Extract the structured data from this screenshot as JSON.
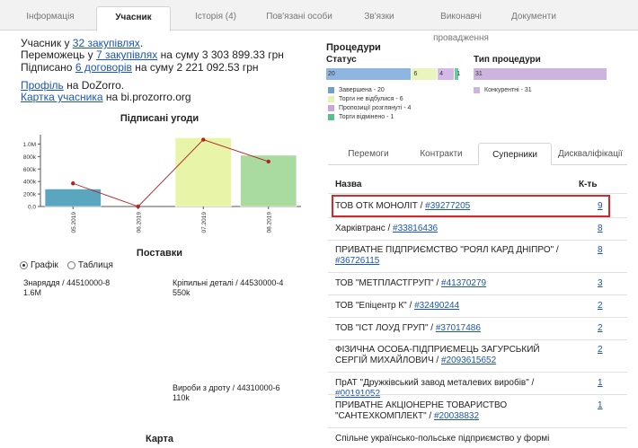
{
  "top_tabs": [
    "Інформація",
    "Учасник",
    "Історія (4)",
    "Пов'язані особи",
    "Зв'язки",
    "Виконавчі провадження",
    "Документи"
  ],
  "info": {
    "line1_pre": "Учасник у ",
    "line1_link": "32 закупівлях",
    "line1_post": ".",
    "line2_pre": "Переможець у ",
    "line2_link": "7 закупівлях",
    "line2_post": " на суму 3 303 899.33 грн",
    "line3_pre": "Підписано ",
    "line3_link": "6 договорів",
    "line3_post": " на суму 2 221 092.53 грн",
    "profile_link": "Профіль",
    "profile_post": " на DoZorro.",
    "card_link": "Картка учасника",
    "card_post": " на bi.prozorro.org"
  },
  "signed_title": "Підписані угоди",
  "chart_data": {
    "type": "bar",
    "categories": [
      "05.2019",
      "06.2019",
      "07.2019",
      "08.2019"
    ],
    "values": [
      280000,
      0,
      1100000,
      820000
    ],
    "line_values": [
      370000,
      0,
      1070000,
      720000
    ],
    "bar_colors": [
      "#5aa6bf",
      "#cccccc",
      "#e8f5a8",
      "#a9dba0"
    ],
    "line_color": "#b22222",
    "ylim": [
      0,
      1150000
    ],
    "yticks": [
      0,
      200000,
      400000,
      600000,
      800000,
      1000000
    ],
    "ytick_labels": [
      "0.0",
      "200k",
      "400k",
      "600k",
      "800k",
      "1.0M"
    ]
  },
  "supplies_title": "Поставки",
  "view_options": [
    "Графік",
    "Таблиця"
  ],
  "treemap": [
    {
      "label": "Знаряддя / 44510000-8",
      "value": "1.6M",
      "color": "#c96b94"
    },
    {
      "label": "Кріпильні деталі / 44530000-4",
      "value": "550k",
      "color": "#e9969f"
    },
    {
      "label": "Вироби з дроту / 44310000-6",
      "value": "110k",
      "color": "#f7b293"
    }
  ],
  "map_title": "Карта",
  "procedures": {
    "title": "Процедури",
    "status_title": "Статус",
    "type_title": "Тип процедури",
    "status_segments": [
      {
        "label": "20",
        "value": 20,
        "color": "#8fb6e0"
      },
      {
        "label": "6",
        "value": 6,
        "color": "#e9f5bc"
      },
      {
        "label": "4",
        "value": 4,
        "color": "#d4b9e6"
      },
      {
        "label": "1",
        "value": 1,
        "color": "#6ccc9c"
      }
    ],
    "status_legend": [
      "Завершена - 20",
      "Торги не відбулися - 6",
      "Пропозиції розглянуті - 4",
      "Торги відмінено - 1"
    ],
    "status_legend_colors": [
      "#6f9fcf",
      "#e6f3b0",
      "#c8a6df",
      "#56c08a"
    ],
    "type_segment_label": "31",
    "type_color": "#cdb4dc",
    "type_legend": "Конкурентні - 31"
  },
  "right_tabs": [
    "Перемоги",
    "Контракти",
    "Суперники",
    "Дискваліфікації"
  ],
  "table": {
    "col_name": "Назва",
    "col_count": "К-ть",
    "rows": [
      {
        "name": "ТОВ ОТК МОНОЛІТ / ",
        "code": "#39277205",
        "count": "9"
      },
      {
        "name": "Харківтранс / ",
        "code": "#33816436",
        "count": "8"
      },
      {
        "name": "ПРИВАТНЕ ПІДПРИЄМСТВО \"РОЯЛ КАРД ДНІПРО\" / ",
        "code": "#36726115",
        "count": "8"
      },
      {
        "name": "ТОВ \"МЕТПЛАСТГРУП\" / ",
        "code": "#41370279",
        "count": "3"
      },
      {
        "name": "ТОВ \"Епіцентр К\" / ",
        "code": "#32490244",
        "count": "2"
      },
      {
        "name": "ТОВ \"ІСТ ЛОУД ГРУП\" / ",
        "code": "#37017486",
        "count": "2"
      },
      {
        "name": "ФІЗИЧНА ОСОБА-ПІДПРИЄМЕЦЬ ЗАГУРСЬКИЙ СЕРГІЙ МИХАЙЛОВИЧ / ",
        "code": "#2093615652",
        "count": "2"
      },
      {
        "name": "ПрАТ \"Дружківський завод металевих виробів\" / ",
        "code": "#00191052",
        "count": "1"
      },
      {
        "name": "ПРИВАТНЕ АКЦІОНЕРНЕ ТОВАРИСТВО \"САНТЕХКОМПЛЕКТ\" / ",
        "code": "#20038832",
        "count": "1"
      },
      {
        "name": "Спільне українсько-польське підприємство у формі",
        "code": "",
        "count": ""
      }
    ]
  }
}
